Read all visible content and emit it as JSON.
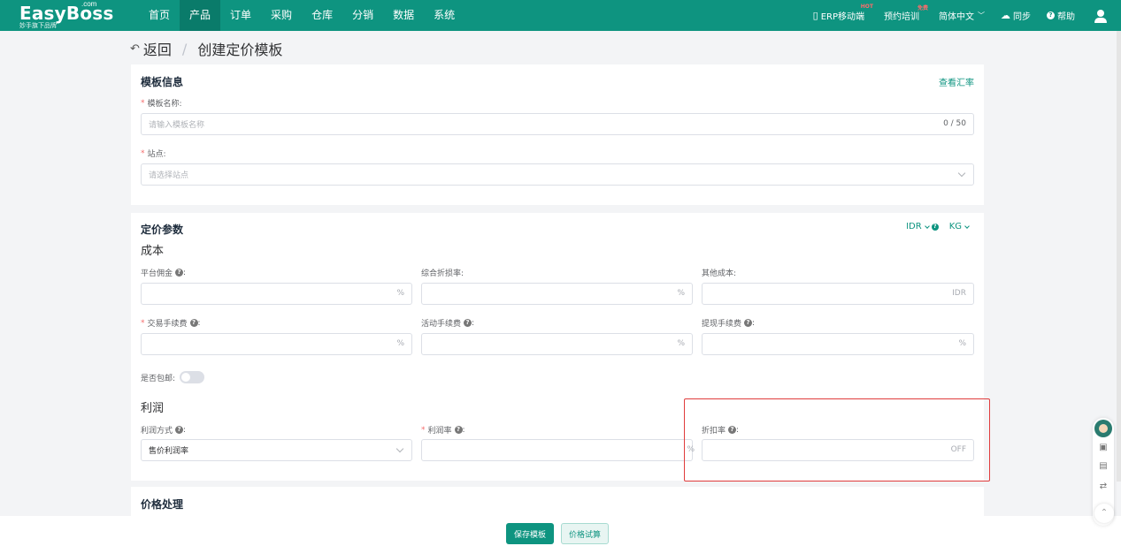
{
  "brand": {
    "name": "EasyBoss",
    "com": ".com",
    "tagline": "妙手旗下品牌"
  },
  "nav": {
    "items": [
      "首页",
      "产品",
      "订单",
      "采购",
      "仓库",
      "分销",
      "数据",
      "系统"
    ],
    "active_index": 1
  },
  "topright": {
    "mobile": "ERP移动端",
    "mobile_badge": "HOT",
    "training": "预约培训",
    "training_badge": "免费",
    "language": "简体中文",
    "sync": "同步",
    "help": "帮助"
  },
  "header": {
    "back": "返回",
    "title": "创建定价模板"
  },
  "template_info": {
    "title": "模板信息",
    "view_rate": "查看汇率",
    "name_label": "模板名称:",
    "name_placeholder": "请输入模板名称",
    "name_count": "0 / 50",
    "site_label": "站点:",
    "site_placeholder": "请选择站点"
  },
  "pricing": {
    "title": "定价参数",
    "currency": "IDR",
    "weight_unit": "KG",
    "cost_section": "成本",
    "platform_commission": "平台佣金",
    "composite_loss": "综合折损率:",
    "other_cost": "其他成本:",
    "transaction_fee": "交易手续费",
    "activity_fee": "活动手续费",
    "withdraw_fee": "提现手续费",
    "free_shipping": "是否包邮:",
    "profit_section": "利润",
    "profit_method": "利润方式",
    "profit_method_value": "售价利润率",
    "profit_rate": "利润率",
    "discount_rate": "折扣率",
    "suffix_percent": "%",
    "suffix_idr": "IDR",
    "suffix_off": "OFF"
  },
  "price_processing": {
    "title": "价格处理"
  },
  "footer": {
    "save": "保存模板",
    "trial": "价格试算"
  }
}
